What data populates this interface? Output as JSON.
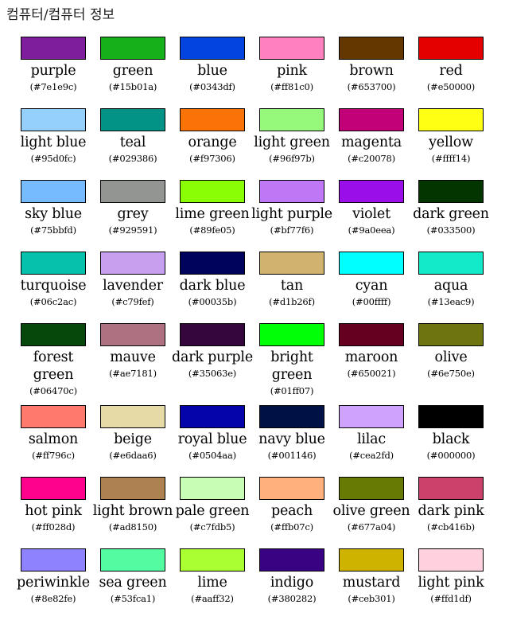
{
  "header": {
    "title": "컴퓨터/컴퓨터 정보"
  },
  "colors": [
    {
      "name": "purple",
      "hex": "(#7e1e9c)",
      "color": "#7e1e9c"
    },
    {
      "name": "green",
      "hex": "(#15b01a)",
      "color": "#15b01a"
    },
    {
      "name": "blue",
      "hex": "(#0343df)",
      "color": "#0343df"
    },
    {
      "name": "pink",
      "hex": "(#ff81c0)",
      "color": "#ff81c0"
    },
    {
      "name": "brown",
      "hex": "(#653700)",
      "color": "#653700"
    },
    {
      "name": "red",
      "hex": "(#e50000)",
      "color": "#e50000"
    },
    {
      "name": "light blue",
      "hex": "(#95d0fc)",
      "color": "#95d0fc"
    },
    {
      "name": "teal",
      "hex": "(#029386)",
      "color": "#029386"
    },
    {
      "name": "orange",
      "hex": "(#f97306)",
      "color": "#f97306"
    },
    {
      "name": "light green",
      "hex": "(#96f97b)",
      "color": "#96f97b"
    },
    {
      "name": "magenta",
      "hex": "(#c20078)",
      "color": "#c20078"
    },
    {
      "name": "yellow",
      "hex": "(#ffff14)",
      "color": "#ffff14"
    },
    {
      "name": "sky blue",
      "hex": "(#75bbfd)",
      "color": "#75bbfd"
    },
    {
      "name": "grey",
      "hex": "(#929591)",
      "color": "#929591"
    },
    {
      "name": "lime green",
      "hex": "(#89fe05)",
      "color": "#89fe05"
    },
    {
      "name": "light purple",
      "hex": "(#bf77f6)",
      "color": "#bf77f6"
    },
    {
      "name": "violet",
      "hex": "(#9a0eea)",
      "color": "#9a0eea"
    },
    {
      "name": "dark green",
      "hex": "(#033500)",
      "color": "#033500"
    },
    {
      "name": "turquoise",
      "hex": "(#06c2ac)",
      "color": "#06c2ac"
    },
    {
      "name": "lavender",
      "hex": "(#c79fef)",
      "color": "#c79fef"
    },
    {
      "name": "dark blue",
      "hex": "(#00035b)",
      "color": "#00035b"
    },
    {
      "name": "tan",
      "hex": "(#d1b26f)",
      "color": "#d1b26f"
    },
    {
      "name": "cyan",
      "hex": "(#00ffff)",
      "color": "#00ffff"
    },
    {
      "name": "aqua",
      "hex": "(#13eac9)",
      "color": "#13eac9"
    },
    {
      "name": "forest green",
      "hex": "(#06470c)",
      "color": "#06470c"
    },
    {
      "name": "mauve",
      "hex": "(#ae7181)",
      "color": "#ae7181"
    },
    {
      "name": "dark purple",
      "hex": "(#35063e)",
      "color": "#35063e"
    },
    {
      "name": "bright green",
      "hex": "(#01ff07)",
      "color": "#01ff07"
    },
    {
      "name": "maroon",
      "hex": "(#650021)",
      "color": "#650021"
    },
    {
      "name": "olive",
      "hex": "(#6e750e)",
      "color": "#6e750e"
    },
    {
      "name": "salmon",
      "hex": "(#ff796c)",
      "color": "#ff796c"
    },
    {
      "name": "beige",
      "hex": "(#e6daa6)",
      "color": "#e6daa6"
    },
    {
      "name": "royal blue",
      "hex": "(#0504aa)",
      "color": "#0504aa"
    },
    {
      "name": "navy blue",
      "hex": "(#001146)",
      "color": "#001146"
    },
    {
      "name": "lilac",
      "hex": "(#cea2fd)",
      "color": "#cea2fd"
    },
    {
      "name": "black",
      "hex": "(#000000)",
      "color": "#000000"
    },
    {
      "name": "hot pink",
      "hex": "(#ff028d)",
      "color": "#ff028d"
    },
    {
      "name": "light brown",
      "hex": "(#ad8150)",
      "color": "#ad8150"
    },
    {
      "name": "pale green",
      "hex": "(#c7fdb5)",
      "color": "#c7fdb5"
    },
    {
      "name": "peach",
      "hex": "(#ffb07c)",
      "color": "#ffb07c"
    },
    {
      "name": "olive green",
      "hex": "(#677a04)",
      "color": "#677a04"
    },
    {
      "name": "dark pink",
      "hex": "(#cb416b)",
      "color": "#cb416b"
    },
    {
      "name": "periwinkle",
      "hex": "(#8e82fe)",
      "color": "#8e82fe"
    },
    {
      "name": "sea green",
      "hex": "(#53fca1)",
      "color": "#53fca1"
    },
    {
      "name": "lime",
      "hex": "(#aaff32)",
      "color": "#aaff32"
    },
    {
      "name": "indigo",
      "hex": "(#380282)",
      "color": "#380282"
    },
    {
      "name": "mustard",
      "hex": "(#ceb301)",
      "color": "#ceb301"
    },
    {
      "name": "light pink",
      "hex": "(#ffd1df)",
      "color": "#ffd1df"
    }
  ]
}
